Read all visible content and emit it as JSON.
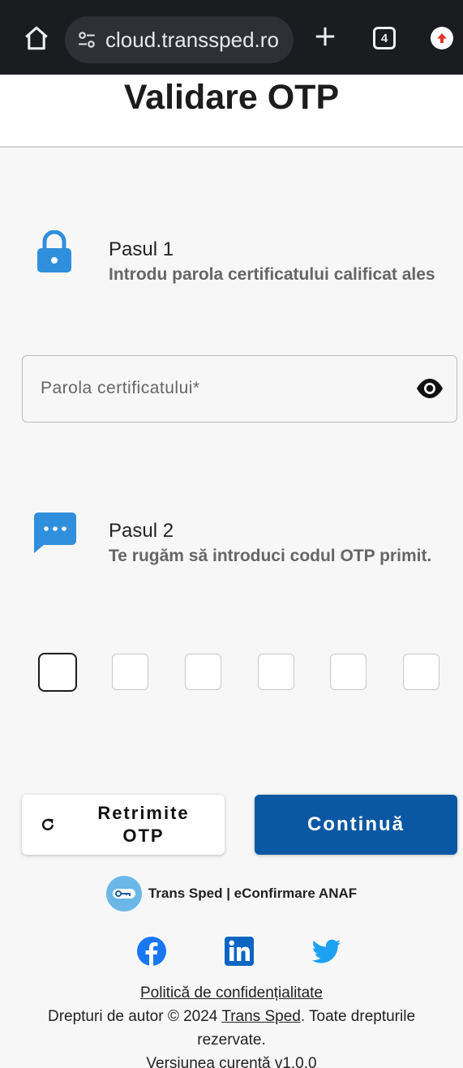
{
  "browser": {
    "url": "cloud.transsped.ro",
    "tab_count": "4",
    "icons": [
      "home-icon",
      "site-settings-icon",
      "new-tab-icon",
      "tab-switcher-icon",
      "extension-icon"
    ]
  },
  "page": {
    "title": "Validare OTP"
  },
  "step1": {
    "title": "Pasul 1",
    "description": "Introdu parola certificatului calificat ales",
    "icon": "lock-icon"
  },
  "password_field": {
    "placeholder": "Parola certificatului*",
    "value": "",
    "icon": "eye-icon"
  },
  "step2": {
    "title": "Pasul 2",
    "description": "Te rugăm să introduci codul OTP primit.",
    "icon": "message-icon"
  },
  "otp": {
    "digits": [
      "",
      "",
      "",
      "",
      "",
      ""
    ]
  },
  "buttons": {
    "resend_line1": "Retrimite",
    "resend_line2": "OTP",
    "continue": "Continuă"
  },
  "brand": {
    "text": "Trans Sped | eConfirmare ANAF"
  },
  "social": [
    "facebook-icon",
    "linkedin-icon",
    "twitter-icon"
  ],
  "footer": {
    "privacy": "Politică de confidențialitate",
    "copyright_prefix": "Drepturi de autor © 2024 ",
    "company_link": "Trans Sped",
    "copyright_suffix": ". Toate drepturile rezervate.",
    "version": "Versiunea curentă v1.0.0"
  },
  "colors": {
    "primary": "#0a58a3",
    "icon_blue": "#2f8fdc",
    "twitter": "#1da1f2",
    "facebook": "#1877f2",
    "linkedin": "#0a66c2"
  }
}
